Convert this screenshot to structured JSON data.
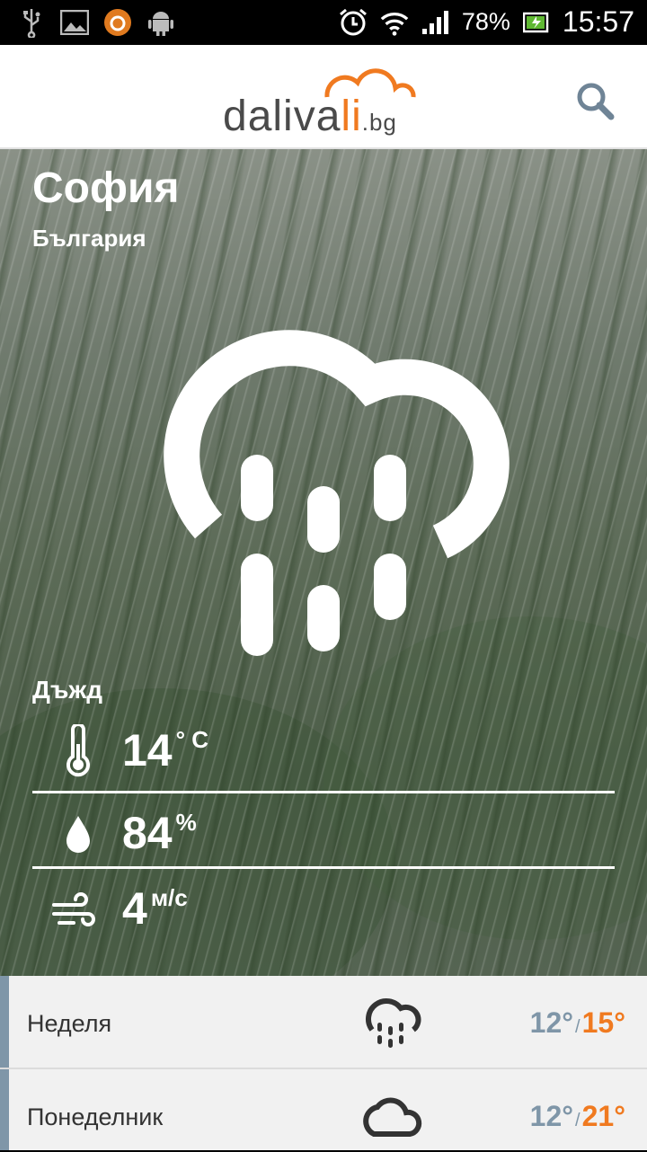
{
  "status_bar": {
    "icons_left": [
      "usb-icon",
      "image-icon",
      "app-notification-icon",
      "android-icon"
    ],
    "battery": "78%",
    "time": "15:57"
  },
  "header": {
    "logo_main": "daliva",
    "logo_accent": "li",
    "logo_suffix": ".bg",
    "brand_color": "#f07a20"
  },
  "weather": {
    "city": "София",
    "country": "България",
    "condition": "Дъжд",
    "temperature": "14",
    "temperature_unit": "° C",
    "humidity": "84",
    "humidity_unit": "%",
    "wind": "4",
    "wind_unit": "м/с"
  },
  "forecast": [
    {
      "day": "Неделя",
      "icon": "rain-cloud-icon",
      "min": "12°",
      "max": "15°"
    },
    {
      "day": "Понеделник",
      "icon": "cloud-icon",
      "min": "12°",
      "max": "21°"
    }
  ],
  "colors": {
    "accent": "#f07a20",
    "muted": "#7f96a8"
  }
}
